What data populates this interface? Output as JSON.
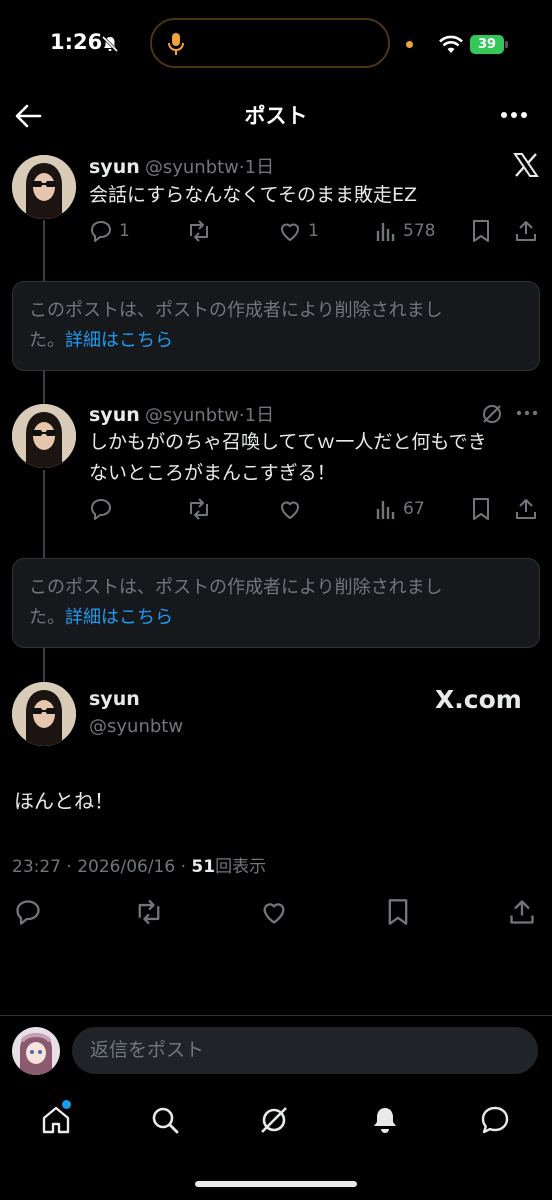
{
  "status_bar": {
    "time": "1:26",
    "battery": "39"
  },
  "header": {
    "title": "ポスト"
  },
  "posts": [
    {
      "name": "syun",
      "handle": "@syunbtw",
      "age": "1日",
      "text": "会話にすらなんなくてそのまま敗走EZ",
      "replies": "1",
      "likes": "1",
      "views": "578"
    },
    {
      "name": "syun",
      "handle": "@syunbtw",
      "age": "1日",
      "text_line1": "しかもがのちゃ召喚しててｗ一人だと何もでき",
      "text_line2": "ないところがまんこすぎる！",
      "views": "67"
    }
  ],
  "deleted_notice": {
    "text": "このポストは、ポストの作成者により削除されまし",
    "text2": "た。",
    "link": "詳細はこちら"
  },
  "main_post": {
    "name": "syun",
    "handle": "@syunbtw",
    "brand": "X.com",
    "text": "ほんとね！",
    "time": "23:27 · 2026/06/16 · ",
    "views_count": "51",
    "views_label": "回表示"
  },
  "reply": {
    "placeholder": "返信をポスト"
  },
  "icons": [
    "back-icon",
    "more-icon",
    "x-logo-icon",
    "reply-icon",
    "repost-icon",
    "like-icon",
    "views-icon",
    "bookmark-icon",
    "share-icon",
    "grok-icon",
    "home-icon",
    "search-icon",
    "bell-icon",
    "messages-icon"
  ],
  "colors": {
    "background": "#000000",
    "link": "#1d9bf0",
    "muted": "#71767b",
    "battery": "#34c759",
    "notification_dot": "#1d9bf0"
  }
}
